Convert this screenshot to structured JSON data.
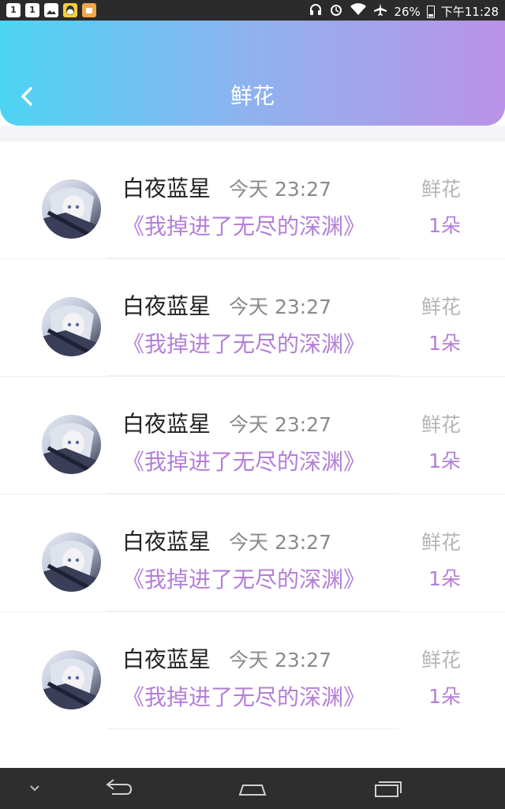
{
  "status_bar": {
    "left_icons": [
      {
        "icon": "app-1-icon",
        "text": "1"
      },
      {
        "icon": "app-1b-icon",
        "text": "1"
      },
      {
        "icon": "gallery-icon",
        "text": ""
      },
      {
        "icon": "qq-icon",
        "text": ""
      },
      {
        "icon": "app-icon",
        "text": ""
      }
    ],
    "battery": "26%",
    "time": "下午11:28"
  },
  "header": {
    "title": "鲜花",
    "gradient_start": "#4dd4f3",
    "gradient_end": "#bb92e8"
  },
  "records": [
    {
      "name": "白夜蓝星",
      "time": "今天 23:27",
      "book": "《我掉进了无尽的深渊》",
      "gift_type": "鲜花",
      "gift_count": "1朵"
    },
    {
      "name": "白夜蓝星",
      "time": "今天 23:27",
      "book": "《我掉进了无尽的深渊》",
      "gift_type": "鲜花",
      "gift_count": "1朵"
    },
    {
      "name": "白夜蓝星",
      "time": "今天 23:27",
      "book": "《我掉进了无尽的深渊》",
      "gift_type": "鲜花",
      "gift_count": "1朵"
    },
    {
      "name": "白夜蓝星",
      "time": "今天 23:27",
      "book": "《我掉进了无尽的深渊》",
      "gift_type": "鲜花",
      "gift_count": "1朵"
    },
    {
      "name": "白夜蓝星",
      "time": "今天 23:27",
      "book": "《我掉进了无尽的深渊》",
      "gift_type": "鲜花",
      "gift_count": "1朵"
    }
  ],
  "colors": {
    "accent_purple": "#b37fd9",
    "name_text": "#222222",
    "muted_text": "#8a8a8a"
  },
  "nav_bar": {
    "icons": [
      "chevron-down-icon",
      "back-icon",
      "home-icon",
      "recents-icon"
    ]
  }
}
